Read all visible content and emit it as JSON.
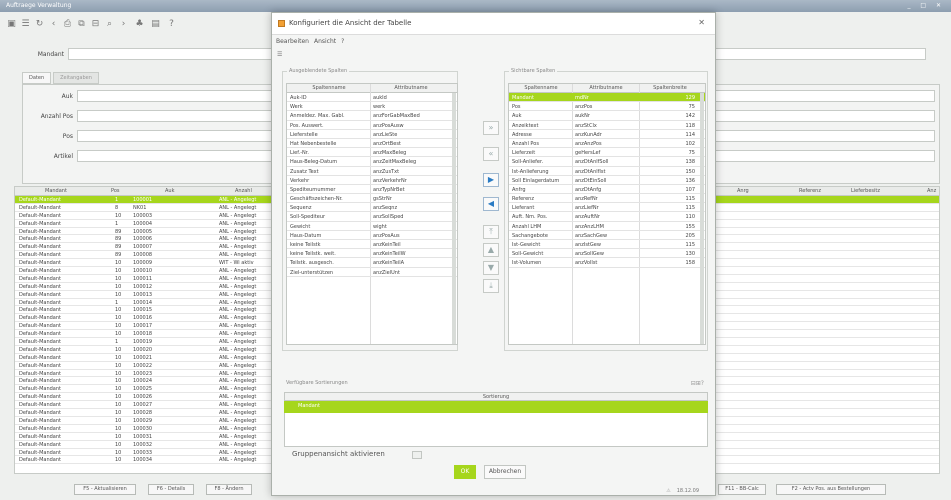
{
  "window": {
    "title": "Auftraege Verwaltung",
    "controls": "_ □ ✕"
  },
  "form": {
    "mandant_label": "Mandant",
    "tabs": [
      "Daten",
      "Zeitangaben"
    ],
    "labels": [
      "Auk",
      "Anzahl Pos",
      "Pos",
      "Artikel"
    ]
  },
  "main_table": {
    "headers": [
      "Mandant",
      "Pos",
      "Auk",
      "Anzahl",
      "Anrg",
      "Referenz",
      "Lieferbesitz",
      "Anz"
    ],
    "rows": [
      {
        "mandant": "Default-Mandant",
        "pos": "1",
        "auk": "100001",
        "anz": "ANL - Angelegt"
      },
      {
        "mandant": "Default-Mandant",
        "pos": "8",
        "auk": "NK01",
        "anz": "ANL - Angelegt"
      },
      {
        "mandant": "Default-Mandant",
        "pos": "10",
        "auk": "100003",
        "anz": "ANL - Angelegt"
      },
      {
        "mandant": "Default-Mandant",
        "pos": "1",
        "auk": "100004",
        "anz": "ANL - Angelegt"
      },
      {
        "mandant": "Default-Mandant",
        "pos": "89",
        "auk": "100005",
        "anz": "ANL - Angelegt"
      },
      {
        "mandant": "Default-Mandant",
        "pos": "89",
        "auk": "100006",
        "anz": "ANL - Angelegt"
      },
      {
        "mandant": "Default-Mandant",
        "pos": "89",
        "auk": "100007",
        "anz": "ANL - Angelegt"
      },
      {
        "mandant": "Default-Mandant",
        "pos": "89",
        "auk": "100008",
        "anz": "ANL - Angelegt"
      },
      {
        "mandant": "Default-Mandant",
        "pos": "10",
        "auk": "100009",
        "anz": "WIT - Wi aktiv"
      },
      {
        "mandant": "Default-Mandant",
        "pos": "10",
        "auk": "100010",
        "anz": "ANL - Angelegt"
      },
      {
        "mandant": "Default-Mandant",
        "pos": "10",
        "auk": "100011",
        "anz": "ANL - Angelegt"
      },
      {
        "mandant": "Default-Mandant",
        "pos": "10",
        "auk": "100012",
        "anz": "ANL - Angelegt"
      },
      {
        "mandant": "Default-Mandant",
        "pos": "10",
        "auk": "100013",
        "anz": "ANL - Angelegt"
      },
      {
        "mandant": "Default-Mandant",
        "pos": "1",
        "auk": "100014",
        "anz": "ANL - Angelegt"
      },
      {
        "mandant": "Default-Mandant",
        "pos": "10",
        "auk": "100015",
        "anz": "ANL - Angelegt"
      },
      {
        "mandant": "Default-Mandant",
        "pos": "10",
        "auk": "100016",
        "anz": "ANL - Angelegt"
      },
      {
        "mandant": "Default-Mandant",
        "pos": "10",
        "auk": "100017",
        "anz": "ANL - Angelegt"
      },
      {
        "mandant": "Default-Mandant",
        "pos": "10",
        "auk": "100018",
        "anz": "ANL - Angelegt"
      },
      {
        "mandant": "Default-Mandant",
        "pos": "1",
        "auk": "100019",
        "anz": "ANL - Angelegt"
      },
      {
        "mandant": "Default-Mandant",
        "pos": "10",
        "auk": "100020",
        "anz": "ANL - Angelegt"
      },
      {
        "mandant": "Default-Mandant",
        "pos": "10",
        "auk": "100021",
        "anz": "ANL - Angelegt"
      },
      {
        "mandant": "Default-Mandant",
        "pos": "10",
        "auk": "100022",
        "anz": "ANL - Angelegt"
      },
      {
        "mandant": "Default-Mandant",
        "pos": "10",
        "auk": "100023",
        "anz": "ANL - Angelegt"
      },
      {
        "mandant": "Default-Mandant",
        "pos": "10",
        "auk": "100024",
        "anz": "ANL - Angelegt"
      },
      {
        "mandant": "Default-Mandant",
        "pos": "10",
        "auk": "100025",
        "anz": "ANL - Angelegt"
      },
      {
        "mandant": "Default-Mandant",
        "pos": "10",
        "auk": "100026",
        "anz": "ANL - Angelegt"
      },
      {
        "mandant": "Default-Mandant",
        "pos": "10",
        "auk": "100027",
        "anz": "ANL - Angelegt"
      },
      {
        "mandant": "Default-Mandant",
        "pos": "10",
        "auk": "100028",
        "anz": "ANL - Angelegt"
      },
      {
        "mandant": "Default-Mandant",
        "pos": "10",
        "auk": "100029",
        "anz": "ANL - Angelegt"
      },
      {
        "mandant": "Default-Mandant",
        "pos": "10",
        "auk": "100030",
        "anz": "ANL - Angelegt"
      },
      {
        "mandant": "Default-Mandant",
        "pos": "10",
        "auk": "100031",
        "anz": "ANL - Angelegt"
      },
      {
        "mandant": "Default-Mandant",
        "pos": "10",
        "auk": "100032",
        "anz": "ANL - Angelegt"
      },
      {
        "mandant": "Default-Mandant",
        "pos": "10",
        "auk": "100033",
        "anz": "ANL - Angelegt"
      },
      {
        "mandant": "Default-Mandant",
        "pos": "10",
        "auk": "100034",
        "anz": "ANL - Angelegt"
      }
    ]
  },
  "bottom_buttons": [
    "F5 - Aktualisieren",
    "F6 - Details",
    "F8 - Ändern",
    "F11 - BB-Calc",
    "F2 - Actv Pos. aus Bestellungen"
  ],
  "dialog": {
    "title": "Konfiguriert die Ansicht der Tabelle",
    "menu": [
      "Bearbeiten",
      "Ansicht",
      "?"
    ],
    "available_group": "Ausgeblendete Spalten",
    "visible_group": "Sichtbare Spalten",
    "left_headers": [
      "Spaltenname",
      "Attributname"
    ],
    "left_rows": [
      [
        "Auk-ID",
        "aukId"
      ],
      [
        "Werk",
        "werk"
      ],
      [
        "Anmeldez. Max. Gabl.",
        "anzForGabMaxBed"
      ],
      [
        "Pos. Auswert.",
        "anzPosAusw"
      ],
      [
        "Lieferstelle",
        "anzLieSte"
      ],
      [
        "Hat Nebenbestelle",
        "anzOrtBest"
      ],
      [
        "Lief.-Nr.",
        "anzMaxBeleg"
      ],
      [
        "Haus-Beleg-Datum",
        "anzZeitMaxBeleg"
      ],
      [
        "Zusatz Text",
        "anzZusTxt"
      ],
      [
        "Verkehr",
        "anzVerkehrNr"
      ],
      [
        "Spediteurnummer",
        "anzTypNrBet"
      ],
      [
        "Geschäftszeichen-Nr.",
        "gsStrNr"
      ],
      [
        "Sequenz",
        "anzSeqnz"
      ],
      [
        "Soll-Spediteur",
        "anzSollSped"
      ],
      [
        "Gewicht",
        "wight"
      ],
      [
        "Haus-Datum",
        "anzPosAus"
      ],
      [
        "keine Teilstk",
        "anzKeinTeil"
      ],
      [
        "keine Teilstk. weit.",
        "anzKeinTeilW"
      ],
      [
        "Teilstk. ausgesch.",
        "anzKeinTeilA"
      ],
      [
        "Ziel-unterstützen",
        "anzZielUnt"
      ]
    ],
    "right_headers": [
      "Spaltenname",
      "Attributname",
      "Spaltenbreite"
    ],
    "right_rows": [
      [
        "Mandant",
        "mdNr",
        "129"
      ],
      [
        "Pos",
        "anzPos",
        "75"
      ],
      [
        "Auk",
        "aukNr",
        "142"
      ],
      [
        "Anzeiktext",
        "anzStClx",
        "118"
      ],
      [
        "Adresse",
        "anzKunAdr",
        "114"
      ],
      [
        "Anzahl Pos",
        "anzAnzPos",
        "102"
      ],
      [
        "Lieferzeit",
        "geHersLef",
        "75"
      ],
      [
        "Soll-Anliefer.",
        "anzDtAnlfSoll",
        "138"
      ],
      [
        "Ist-Anlieferung",
        "anzDtAnlfIst",
        "150"
      ],
      [
        "Soll Einlagerdatum",
        "anzDtEinSoll",
        "136"
      ],
      [
        "Anfrg",
        "anzDtAnfg",
        "107"
      ],
      [
        "Referenz",
        "anzRefNr",
        "115"
      ],
      [
        "Lieferant",
        "anzLiefNr",
        "115"
      ],
      [
        "Auft. Nm. Pos.",
        "anzAuftNr",
        "110"
      ],
      [
        "Anzahl LHM",
        "anzAnzLHM",
        "155"
      ],
      [
        "Sachangebote",
        "anzSachGew",
        "205"
      ],
      [
        "Ist-Gewicht",
        "anzIstGew",
        "115"
      ],
      [
        "Soll-Gewicht",
        "anzSollGew",
        "130"
      ],
      [
        "Ist-Volumen",
        "anzVolIst",
        "158"
      ]
    ],
    "sort_group": "Verfügbare Sortierungen",
    "sort_header": "Sortierung",
    "sort_rows": [
      "Mandant"
    ],
    "group_label": "Gruppenansicht aktivieren",
    "ok": "OK",
    "cancel": "Abbrechen",
    "status": "18.12.09"
  },
  "colors": {
    "selection": "#a6d61c",
    "window_title": "#8d9eb0"
  }
}
